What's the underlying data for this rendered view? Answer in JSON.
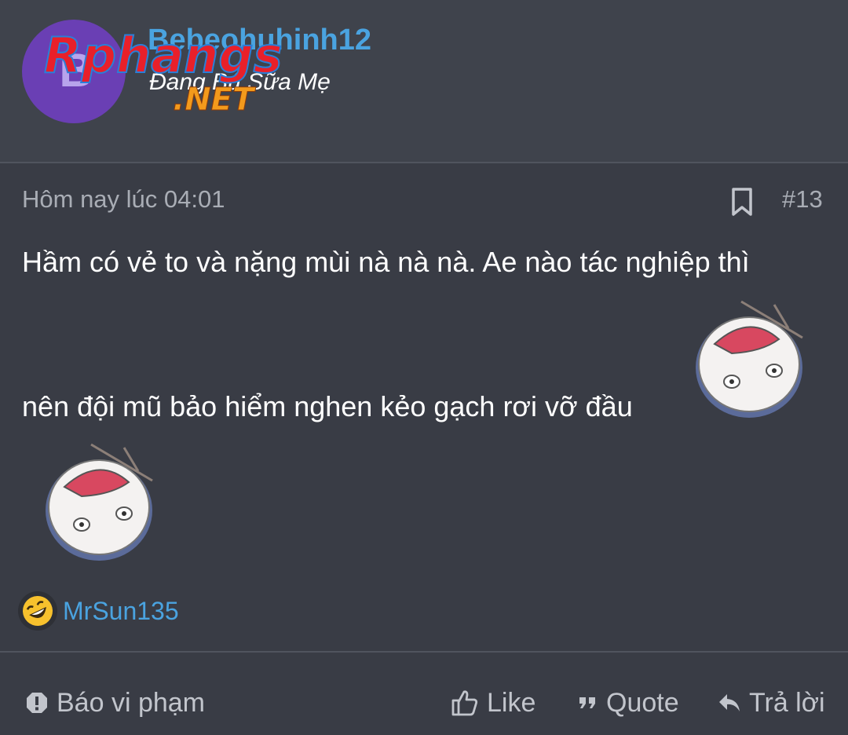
{
  "author": {
    "username": "Bebeohuhinh12",
    "avatar_letter": "B",
    "user_title": "Đang Bú Sữa Mẹ"
  },
  "watermark": {
    "text_top": "Rphangs",
    "text_bottom": ".NET"
  },
  "post": {
    "timestamp": "Hôm nay lúc 04:01",
    "number": "#13",
    "line1": "Hầm có vẻ to và nặng mùi nà nà nà. Ae nào tác nghiệp thì",
    "line2": "nên đội mũ bảo hiểm nghen kẻo gạch rơi vỡ đầu",
    "stickers": [
      "sticker-upside-down-blob",
      "sticker-upside-down-blob"
    ]
  },
  "reactions": {
    "icon": "laughing-emoji-icon",
    "users": "MrSun135"
  },
  "actions": {
    "report": "Báo vi phạm",
    "like": "Like",
    "quote": "Quote",
    "reply": "Trả lời"
  },
  "colors": {
    "background": "#393c45",
    "header_bg": "#3f434c",
    "link": "#4aa3e0",
    "muted": "#a9adb5",
    "avatar": "#6a3fb4"
  }
}
